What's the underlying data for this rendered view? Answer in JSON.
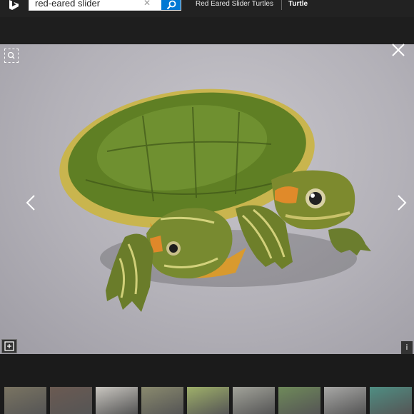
{
  "search": {
    "value": "red-eared slider"
  },
  "related_searches": [
    "Red Eared Slider Turtles",
    "Turtle"
  ],
  "info_label": "i",
  "thumbnails": [
    {
      "name": "thumb-1",
      "color": "#7a7462"
    },
    {
      "name": "thumb-2",
      "color": "#6b5a52"
    },
    {
      "name": "thumb-3",
      "color": "#c9c6c0"
    },
    {
      "name": "thumb-4",
      "color": "#8a8a6e"
    },
    {
      "name": "thumb-5",
      "color": "#9fb06a"
    },
    {
      "name": "thumb-6",
      "color": "#a2a39a"
    },
    {
      "name": "thumb-7",
      "color": "#6f8a5a"
    },
    {
      "name": "thumb-8",
      "color": "#a8a8a6"
    },
    {
      "name": "thumb-9",
      "color": "#4f8e83"
    }
  ]
}
